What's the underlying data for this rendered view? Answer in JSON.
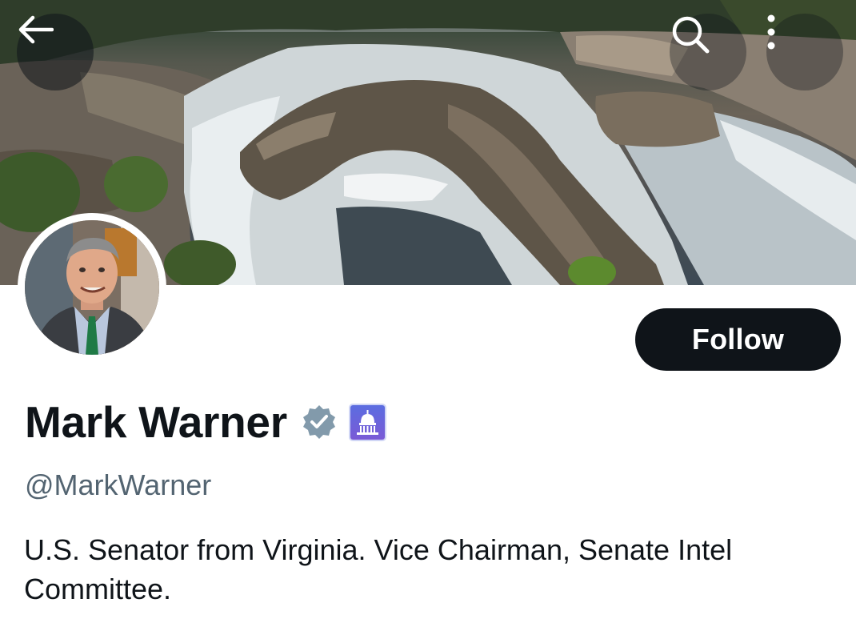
{
  "profile": {
    "display_name": "Mark Warner",
    "handle": "@MarkWarner",
    "bio": "U.S. Senator from Virginia. Vice Chairman, Senate Intel Committee.",
    "verified": true,
    "verified_color": "#829aab",
    "affiliate_badge": "us-capitol-badge"
  },
  "actions": {
    "follow_label": "Follow"
  },
  "header": {
    "back_icon": "back-arrow-icon",
    "search_icon": "search-icon",
    "more_icon": "more-vertical-icon"
  },
  "colors": {
    "primary_text": "#0f1419",
    "secondary_text": "#536471",
    "button_bg": "#0f1419",
    "button_text": "#ffffff"
  }
}
